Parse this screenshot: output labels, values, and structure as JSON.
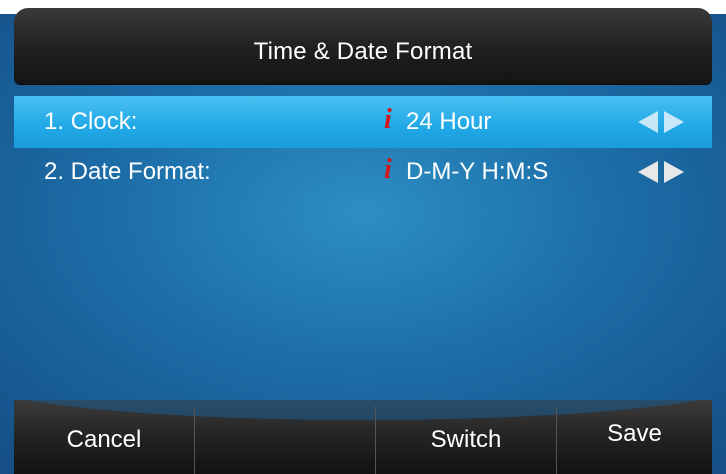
{
  "header": {
    "title": "Time & Date Format"
  },
  "rows": [
    {
      "label": "1. Clock:",
      "value": "24 Hour",
      "info_icon": "i",
      "selected": true
    },
    {
      "label": "2. Date Format:",
      "value": "D-M-Y H:M:S",
      "info_icon": "i",
      "selected": false
    }
  ],
  "softkeys": [
    {
      "label": "Cancel"
    },
    {
      "label": ""
    },
    {
      "label": "Switch"
    },
    {
      "label": "Save"
    }
  ],
  "colors": {
    "selected_row": "#21a8e6",
    "background": "#1d6ea8",
    "info_icon": "#d4161c"
  }
}
